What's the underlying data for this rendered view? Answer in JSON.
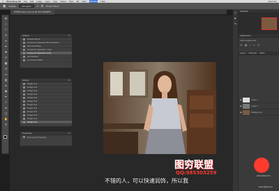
{
  "menubar": {
    "app_name": "Photoshop CC",
    "items": [
      "File",
      "Edit",
      "Image",
      "Layer",
      "Type",
      "Select",
      "Filter",
      "3D",
      "View",
      "Window",
      "Help"
    ],
    "active_item": "Window",
    "right_text": "Joel Grim"
  },
  "optionsbar": {
    "sample_label": "Sample:",
    "sample_value": "All Layers",
    "checkbox_label": "Protect Tones",
    "app_title": "Adobe Photoshop CC 2015"
  },
  "document": {
    "tab_label": "WORKLauren_01.psd @ 33% (RGB/8*)"
  },
  "history_panel": {
    "title": "Actions",
    "items": [
      "Default Actions",
      "Frequency Separation Brush Method",
      "Skin Smoothing",
      "Frequency Separation Layer",
      "Frequency Separation Hold",
      "Lab Sharpen",
      "Luminosity Masks"
    ]
  },
  "history_states": {
    "title": "History",
    "items": [
      "Dodge Tool",
      "Dodge Tool",
      "Dodge Tool",
      "Dodge Tool",
      "Dodge Tool",
      "Dodge Tool",
      "Dodge Tool",
      "Dodge Tool",
      "Dodge Tool",
      "Dodge Tool",
      "Dodge Tool",
      "Dodge Tool",
      "Dodge Tool"
    ]
  },
  "properties_panel": {
    "title": "Properties",
    "subtitle": "Pixel Layer Properties"
  },
  "dock": {
    "navigator_tab": "Navigator",
    "adjustments_tab": "Adjustments",
    "adjustments_sub": "Add an adjustment",
    "layers_tabs": [
      "Layers",
      "Channels",
      "Paths"
    ],
    "layers": [
      {
        "name": "Layer 1"
      },
      {
        "name": "Layer 0"
      },
      {
        "name": "Background"
      }
    ]
  },
  "subtitle": "不错的人，可以快速润饰，所以我",
  "watermark": {
    "title": "图穷联盟",
    "qq": "QQ:985303259",
    "site_line": "www.xjfdy.com",
    "site_line2": "www.xjfdy.com"
  },
  "colors": {
    "ui_dark": "#282828",
    "panel": "#404040",
    "accent_red": "#ff3b2f",
    "menu_active": "#3a78d8"
  }
}
